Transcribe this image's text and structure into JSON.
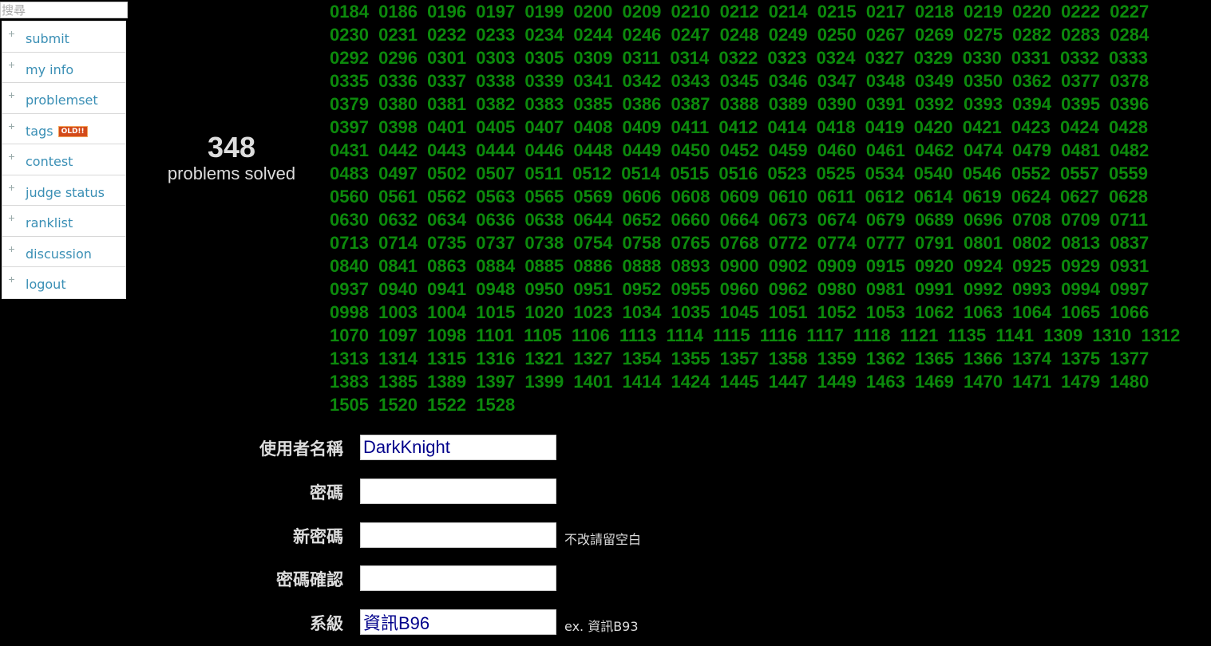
{
  "search": {
    "placeholder": "搜尋"
  },
  "nav": {
    "items": [
      {
        "label": "submit"
      },
      {
        "label": "my info"
      },
      {
        "label": "problemset"
      },
      {
        "label": "tags",
        "badge": "OLD!!"
      },
      {
        "label": "contest"
      },
      {
        "label": "judge status"
      },
      {
        "label": "ranklist"
      },
      {
        "label": "discussion"
      },
      {
        "label": "logout"
      }
    ]
  },
  "stats": {
    "solved_count": "348",
    "solved_label": "problems solved"
  },
  "problems": [
    "0184",
    "0186",
    "0196",
    "0197",
    "0199",
    "0200",
    "0209",
    "0210",
    "0212",
    "0214",
    "0215",
    "0217",
    "0218",
    "0219",
    "0220",
    "0222",
    "0227",
    "0230",
    "0231",
    "0232",
    "0233",
    "0234",
    "0244",
    "0246",
    "0247",
    "0248",
    "0249",
    "0250",
    "0267",
    "0269",
    "0275",
    "0282",
    "0283",
    "0284",
    "0292",
    "0296",
    "0301",
    "0303",
    "0305",
    "0309",
    "0311",
    "0314",
    "0322",
    "0323",
    "0324",
    "0327",
    "0329",
    "0330",
    "0331",
    "0332",
    "0333",
    "0335",
    "0336",
    "0337",
    "0338",
    "0339",
    "0341",
    "0342",
    "0343",
    "0345",
    "0346",
    "0347",
    "0348",
    "0349",
    "0350",
    "0362",
    "0377",
    "0378",
    "0379",
    "0380",
    "0381",
    "0382",
    "0383",
    "0385",
    "0386",
    "0387",
    "0388",
    "0389",
    "0390",
    "0391",
    "0392",
    "0393",
    "0394",
    "0395",
    "0396",
    "0397",
    "0398",
    "0401",
    "0405",
    "0407",
    "0408",
    "0409",
    "0411",
    "0412",
    "0414",
    "0418",
    "0419",
    "0420",
    "0421",
    "0423",
    "0424",
    "0428",
    "0431",
    "0442",
    "0443",
    "0444",
    "0446",
    "0448",
    "0449",
    "0450",
    "0452",
    "0459",
    "0460",
    "0461",
    "0462",
    "0474",
    "0479",
    "0481",
    "0482",
    "0483",
    "0497",
    "0502",
    "0507",
    "0511",
    "0512",
    "0514",
    "0515",
    "0516",
    "0523",
    "0525",
    "0534",
    "0540",
    "0546",
    "0552",
    "0557",
    "0559",
    "0560",
    "0561",
    "0562",
    "0563",
    "0565",
    "0569",
    "0606",
    "0608",
    "0609",
    "0610",
    "0611",
    "0612",
    "0614",
    "0619",
    "0624",
    "0627",
    "0628",
    "0630",
    "0632",
    "0634",
    "0636",
    "0638",
    "0644",
    "0652",
    "0660",
    "0664",
    "0673",
    "0674",
    "0679",
    "0689",
    "0696",
    "0708",
    "0709",
    "0711",
    "0713",
    "0714",
    "0735",
    "0737",
    "0738",
    "0754",
    "0758",
    "0765",
    "0768",
    "0772",
    "0774",
    "0777",
    "0791",
    "0801",
    "0802",
    "0813",
    "0837",
    "0840",
    "0841",
    "0863",
    "0884",
    "0885",
    "0886",
    "0888",
    "0893",
    "0900",
    "0902",
    "0909",
    "0915",
    "0920",
    "0924",
    "0925",
    "0929",
    "0931",
    "0937",
    "0940",
    "0941",
    "0948",
    "0950",
    "0951",
    "0952",
    "0955",
    "0960",
    "0962",
    "0980",
    "0981",
    "0991",
    "0992",
    "0993",
    "0994",
    "0997",
    "0998",
    "1003",
    "1004",
    "1015",
    "1020",
    "1023",
    "1034",
    "1035",
    "1045",
    "1051",
    "1052",
    "1053",
    "1062",
    "1063",
    "1064",
    "1065",
    "1066",
    "1070",
    "1097",
    "1098",
    "1101",
    "1105",
    "1106",
    "1113",
    "1114",
    "1115",
    "1116",
    "1117",
    "1118",
    "1121",
    "1135",
    "1141",
    "1309",
    "1310",
    "1312",
    "1313",
    "1314",
    "1315",
    "1316",
    "1321",
    "1327",
    "1354",
    "1355",
    "1357",
    "1358",
    "1359",
    "1362",
    "1365",
    "1366",
    "1374",
    "1375",
    "1377",
    "1383",
    "1385",
    "1389",
    "1397",
    "1399",
    "1401",
    "1414",
    "1424",
    "1445",
    "1447",
    "1449",
    "1463",
    "1469",
    "1470",
    "1471",
    "1479",
    "1480",
    "1505",
    "1520",
    "1522",
    "1528"
  ],
  "form": {
    "username_label": "使用者名稱",
    "username_value": "DarkKnight",
    "password_label": "密碼",
    "password_value": "",
    "new_password_label": "新密碼",
    "new_password_value": "",
    "new_password_hint": "不改請留空白",
    "confirm_label": "密碼確認",
    "confirm_value": "",
    "dept_label": "系級",
    "dept_value": "資訊B96",
    "dept_hint": "ex. 資訊B93"
  },
  "colors": {
    "background": "#000000",
    "problem_green": "#0c8a0c",
    "nav_link": "#3a8fb5",
    "input_text": "#00008b"
  }
}
